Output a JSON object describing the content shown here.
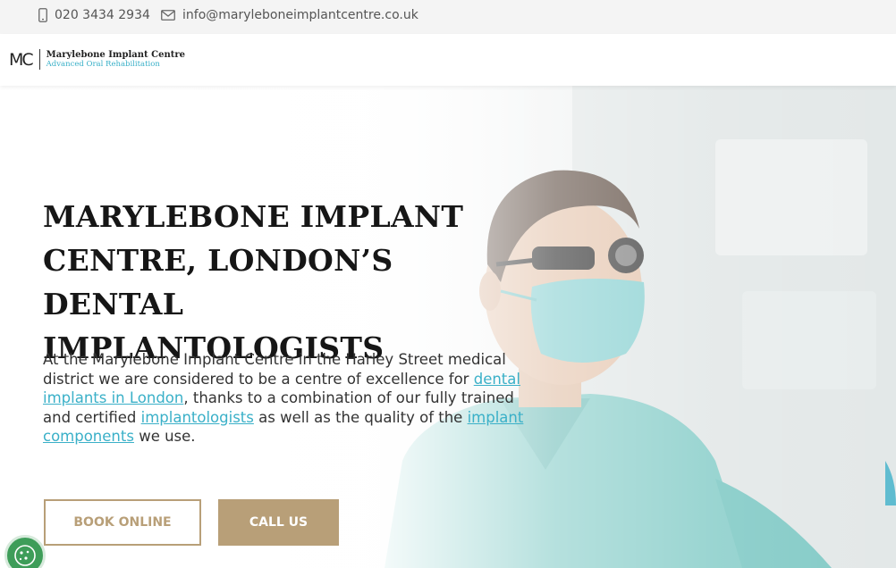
{
  "topbar": {
    "phone": "020 3434 2934",
    "email": "info@maryleboneimplantcentre.co.uk",
    "phone_icon": "phone-icon",
    "email_icon": "envelope-icon"
  },
  "header": {
    "logo_mark": "MC",
    "logo_name": "Marylebone Implant Centre",
    "logo_tagline": "Advanced Oral Rehabilitation"
  },
  "hero": {
    "title_lines": [
      "MARYLEBONE IMPLANT",
      "CENTRE, LONDON’S DENTAL",
      "IMPLANTOLOGISTS"
    ],
    "intro_1": "At the Marylebone Implant Centre in the Harley Street medical district we are considered to be a centre of excellence for ",
    "link_1": "dental implants in London",
    "intro_2": ", thanks to a combination of our fully trained and certified ",
    "link_2": "implantologists",
    "intro_3": " as well as the quality of the ",
    "link_3": "implant components",
    "intro_4": " we use.",
    "book_label": "Book Online",
    "call_label": "Call Us"
  },
  "cookie": {
    "icon": "cookie-icon"
  },
  "colors": {
    "accent_gold": "#b89f78",
    "link_teal": "#3ab0c8",
    "cookie_green": "#3e9d59",
    "topbar_bg": "#f4f4f4"
  }
}
